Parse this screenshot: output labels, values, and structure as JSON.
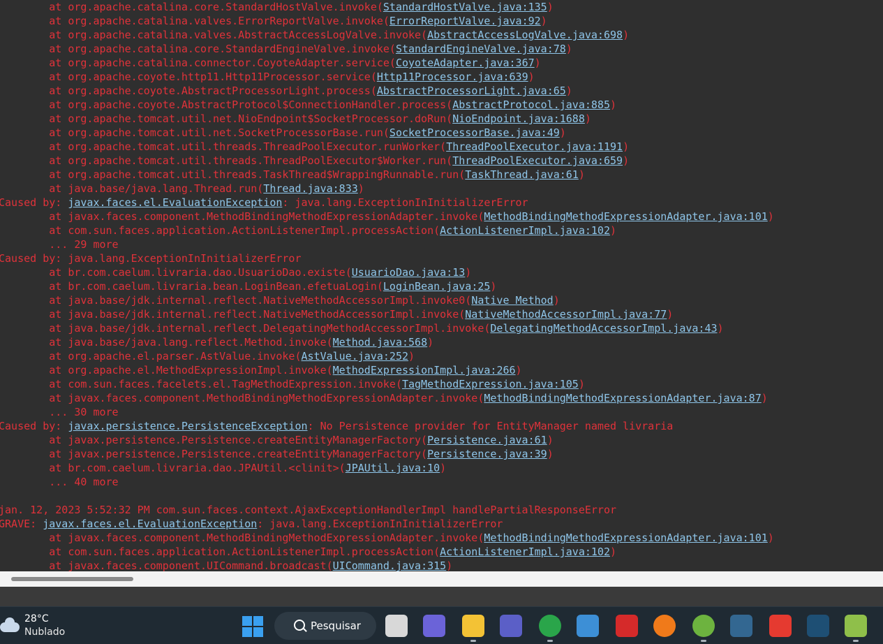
{
  "console": {
    "lines": [
      [
        {
          "t": "        at org.apache.catalina.core.StandardHostValve.invoke("
        },
        {
          "t": "StandardHostValve.java:135",
          "l": 1
        },
        {
          "t": ")"
        }
      ],
      [
        {
          "t": "        at org.apache.catalina.valves.ErrorReportValve.invoke("
        },
        {
          "t": "ErrorReportValve.java:92",
          "l": 1
        },
        {
          "t": ")"
        }
      ],
      [
        {
          "t": "        at org.apache.catalina.valves.AbstractAccessLogValve.invoke("
        },
        {
          "t": "AbstractAccessLogValve.java:698",
          "l": 1
        },
        {
          "t": ")"
        }
      ],
      [
        {
          "t": "        at org.apache.catalina.core.StandardEngineValve.invoke("
        },
        {
          "t": "StandardEngineValve.java:78",
          "l": 1
        },
        {
          "t": ")"
        }
      ],
      [
        {
          "t": "        at org.apache.catalina.connector.CoyoteAdapter.service("
        },
        {
          "t": "CoyoteAdapter.java:367",
          "l": 1
        },
        {
          "t": ")"
        }
      ],
      [
        {
          "t": "        at org.apache.coyote.http11.Http11Processor.service("
        },
        {
          "t": "Http11Processor.java:639",
          "l": 1
        },
        {
          "t": ")"
        }
      ],
      [
        {
          "t": "        at org.apache.coyote.AbstractProcessorLight.process("
        },
        {
          "t": "AbstractProcessorLight.java:65",
          "l": 1
        },
        {
          "t": ")"
        }
      ],
      [
        {
          "t": "        at org.apache.coyote.AbstractProtocol$ConnectionHandler.process("
        },
        {
          "t": "AbstractProtocol.java:885",
          "l": 1
        },
        {
          "t": ")"
        }
      ],
      [
        {
          "t": "        at org.apache.tomcat.util.net.NioEndpoint$SocketProcessor.doRun("
        },
        {
          "t": "NioEndpoint.java:1688",
          "l": 1
        },
        {
          "t": ")"
        }
      ],
      [
        {
          "t": "        at org.apache.tomcat.util.net.SocketProcessorBase.run("
        },
        {
          "t": "SocketProcessorBase.java:49",
          "l": 1
        },
        {
          "t": ")"
        }
      ],
      [
        {
          "t": "        at org.apache.tomcat.util.threads.ThreadPoolExecutor.runWorker("
        },
        {
          "t": "ThreadPoolExecutor.java:1191",
          "l": 1
        },
        {
          "t": ")"
        }
      ],
      [
        {
          "t": "        at org.apache.tomcat.util.threads.ThreadPoolExecutor$Worker.run("
        },
        {
          "t": "ThreadPoolExecutor.java:659",
          "l": 1
        },
        {
          "t": ")"
        }
      ],
      [
        {
          "t": "        at org.apache.tomcat.util.threads.TaskThread$WrappingRunnable.run("
        },
        {
          "t": "TaskThread.java:61",
          "l": 1
        },
        {
          "t": ")"
        }
      ],
      [
        {
          "t": "        at java.base/java.lang.Thread.run("
        },
        {
          "t": "Thread.java:833",
          "l": 1
        },
        {
          "t": ")"
        }
      ],
      [
        {
          "t": "Caused by: "
        },
        {
          "t": "javax.faces.el.EvaluationException",
          "l": 1
        },
        {
          "t": ": java.lang.ExceptionInInitializerError"
        }
      ],
      [
        {
          "t": "        at javax.faces.component.MethodBindingMethodExpressionAdapter.invoke("
        },
        {
          "t": "MethodBindingMethodExpressionAdapter.java:101",
          "l": 1
        },
        {
          "t": ")"
        }
      ],
      [
        {
          "t": "        at com.sun.faces.application.ActionListenerImpl.processAction("
        },
        {
          "t": "ActionListenerImpl.java:102",
          "l": 1
        },
        {
          "t": ")"
        }
      ],
      [
        {
          "t": "        ... 29 more"
        }
      ],
      [
        {
          "t": "Caused by: java.lang.ExceptionInInitializerError"
        }
      ],
      [
        {
          "t": "        at br.com.caelum.livraria.dao.UsuarioDao.existe("
        },
        {
          "t": "UsuarioDao.java:13",
          "l": 1
        },
        {
          "t": ")"
        }
      ],
      [
        {
          "t": "        at br.com.caelum.livraria.bean.LoginBean.efetuaLogin("
        },
        {
          "t": "LoginBean.java:25",
          "l": 1
        },
        {
          "t": ")"
        }
      ],
      [
        {
          "t": "        at java.base/jdk.internal.reflect.NativeMethodAccessorImpl.invoke0("
        },
        {
          "t": "Native Method",
          "l": 1
        },
        {
          "t": ")"
        }
      ],
      [
        {
          "t": "        at java.base/jdk.internal.reflect.NativeMethodAccessorImpl.invoke("
        },
        {
          "t": "NativeMethodAccessorImpl.java:77",
          "l": 1
        },
        {
          "t": ")"
        }
      ],
      [
        {
          "t": "        at java.base/jdk.internal.reflect.DelegatingMethodAccessorImpl.invoke("
        },
        {
          "t": "DelegatingMethodAccessorImpl.java:43",
          "l": 1
        },
        {
          "t": ")"
        }
      ],
      [
        {
          "t": "        at java.base/java.lang.reflect.Method.invoke("
        },
        {
          "t": "Method.java:568",
          "l": 1
        },
        {
          "t": ")"
        }
      ],
      [
        {
          "t": "        at org.apache.el.parser.AstValue.invoke("
        },
        {
          "t": "AstValue.java:252",
          "l": 1
        },
        {
          "t": ")"
        }
      ],
      [
        {
          "t": "        at org.apache.el.MethodExpressionImpl.invoke("
        },
        {
          "t": "MethodExpressionImpl.java:266",
          "l": 1
        },
        {
          "t": ")"
        }
      ],
      [
        {
          "t": "        at com.sun.faces.facelets.el.TagMethodExpression.invoke("
        },
        {
          "t": "TagMethodExpression.java:105",
          "l": 1
        },
        {
          "t": ")"
        }
      ],
      [
        {
          "t": "        at javax.faces.component.MethodBindingMethodExpressionAdapter.invoke("
        },
        {
          "t": "MethodBindingMethodExpressionAdapter.java:87",
          "l": 1
        },
        {
          "t": ")"
        }
      ],
      [
        {
          "t": "        ... 30 more"
        }
      ],
      [
        {
          "t": "Caused by: "
        },
        {
          "t": "javax.persistence.PersistenceException",
          "l": 1
        },
        {
          "t": ": No Persistence provider for EntityManager named livraria"
        }
      ],
      [
        {
          "t": "        at javax.persistence.Persistence.createEntityManagerFactory("
        },
        {
          "t": "Persistence.java:61",
          "l": 1
        },
        {
          "t": ")"
        }
      ],
      [
        {
          "t": "        at javax.persistence.Persistence.createEntityManagerFactory("
        },
        {
          "t": "Persistence.java:39",
          "l": 1
        },
        {
          "t": ")"
        }
      ],
      [
        {
          "t": "        at br.com.caelum.livraria.dao.JPAUtil.<clinit>("
        },
        {
          "t": "JPAUtil.java:10",
          "l": 1
        },
        {
          "t": ")"
        }
      ],
      [
        {
          "t": "        ... 40 more"
        }
      ],
      [
        {
          "t": ""
        }
      ],
      [
        {
          "t": "jan. 12, 2023 5:52:32 PM com.sun.faces.context.AjaxExceptionHandlerImpl handlePartialResponseError"
        }
      ],
      [
        {
          "t": "GRAVE: "
        },
        {
          "t": "javax.faces.el.EvaluationException",
          "l": 1
        },
        {
          "t": ": java.lang.ExceptionInInitializerError"
        }
      ],
      [
        {
          "t": "        at javax.faces.component.MethodBindingMethodExpressionAdapter.invoke("
        },
        {
          "t": "MethodBindingMethodExpressionAdapter.java:101",
          "l": 1
        },
        {
          "t": ")"
        }
      ],
      [
        {
          "t": "        at com.sun.faces.application.ActionListenerImpl.processAction("
        },
        {
          "t": "ActionListenerImpl.java:102",
          "l": 1
        },
        {
          "t": ")"
        }
      ],
      [
        {
          "t": "        at javax.faces.component.UICommand.broadcast("
        },
        {
          "t": "UICommand.java:315",
          "l": 1
        },
        {
          "t": ")"
        }
      ]
    ]
  },
  "colors": {
    "error_text": "#e0323a",
    "link": "#8fc6ea",
    "console_bg": "#2f2f2f",
    "taskbar_bg": "#1f2a33"
  },
  "taskbar": {
    "weather": {
      "temp": "28°C",
      "condition": "Nublado",
      "icon": "cloud-icon"
    },
    "search": {
      "label": "Pesquisar",
      "icon": "search-icon"
    },
    "apps": [
      {
        "name": "task-view",
        "color": "#d8d8d8",
        "running": false
      },
      {
        "name": "teams-chat",
        "color": "#6b63d8",
        "running": false
      },
      {
        "name": "file-explorer",
        "color": "#f3c235",
        "running": true
      },
      {
        "name": "microsoft-teams",
        "color": "#5b5fc7",
        "running": false
      },
      {
        "name": "chrome",
        "color": "#2aa54a",
        "running": true
      },
      {
        "name": "control-panel",
        "color": "#3d8fd6",
        "running": false
      },
      {
        "name": "mcafee",
        "color": "#d52a2a",
        "running": false
      },
      {
        "name": "firefox",
        "color": "#f07a1a",
        "running": false
      },
      {
        "name": "spring-tool-suite",
        "color": "#6db33f",
        "running": true
      },
      {
        "name": "postgresql",
        "color": "#336791",
        "running": false
      },
      {
        "name": "anydesk",
        "color": "#e53a30",
        "running": false
      },
      {
        "name": "mysql-workbench",
        "color": "#1e4f74",
        "running": false
      },
      {
        "name": "notepad-plus-plus",
        "color": "#8fbf4a",
        "running": true
      }
    ]
  }
}
